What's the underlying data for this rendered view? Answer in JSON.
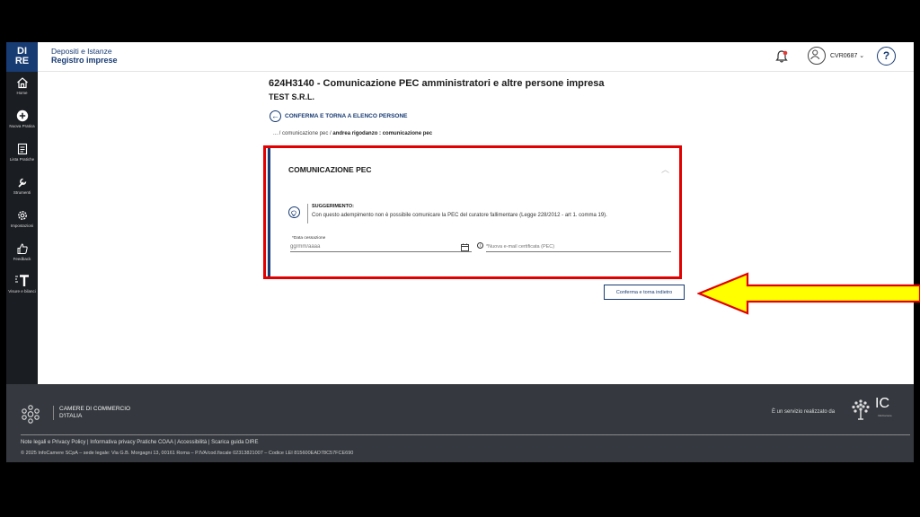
{
  "header": {
    "logo_line1": "DI",
    "logo_line2": "RE",
    "crumb_top": "Depositi e Istanze",
    "crumb_main": "Registro imprese",
    "user": "CVR0687 ⌄",
    "help": "?"
  },
  "sidebar": {
    "items": [
      {
        "label": "Home",
        "icon": "home-icon"
      },
      {
        "label": "Nuova Pratica",
        "icon": "plus-circle-icon"
      },
      {
        "label": "Lista Pratiche",
        "icon": "document-list-icon"
      },
      {
        "label": "Strumenti",
        "icon": "wrench-icon"
      },
      {
        "label": "Impostazioni",
        "icon": "gear-icon"
      },
      {
        "label": "Feedback",
        "icon": "thumbs-up-icon"
      },
      {
        "label": "Visure e bilanci",
        "icon": "visure-t-icon"
      }
    ]
  },
  "main": {
    "title": "624H3140 - Comunicazione PEC amministratori e altre persone impresa",
    "company": "TEST S.R.L.",
    "back_link": "CONFERMA E TORNA A ELENCO PERSONE",
    "path_prefix": "... / comunicazione pec / ",
    "path_current": "andrea rigodanzo : comunicazione pec",
    "card": {
      "title": "COMUNICAZIONE PEC",
      "hint_title": "SUGGERIMENTO:",
      "hint_text": "Con questo adempimento non è possibile comunicare la PEC del curatore fallimentare (Legge 228/2012 - art 1. comma 19).",
      "date_label": "*Data cessazione",
      "date_placeholder": "gg/mm/aaaa",
      "pec_placeholder": "*Nuova e-mail certificata (PEC)"
    },
    "confirm_button": "Conferma e torna indietro"
  },
  "footer": {
    "org_line1": "CAMERE DI COMMERCIO",
    "org_line2": "D'ITALIA",
    "service_text": "È un servizio realizzato da",
    "ic_logo": "IC",
    "ic_sub": "InfoCamere",
    "links": "Note legali e Privacy Policy  |  Informativa privacy Pratiche COAA  |  Accessibilità  |  Scarica guida DIRE",
    "copyright": "© 2025 InfoCamere SCpA – sede legale: Via G.B. Morgagni 13, 00161 Roma – P.IVA/cod.fiscale 02313821007 – Codice LEI 815600EAD78C57FCE690"
  },
  "colors": {
    "brand_navy": "#173b73",
    "highlight_red": "#e20000",
    "arrow_yellow": "#ffff00"
  }
}
